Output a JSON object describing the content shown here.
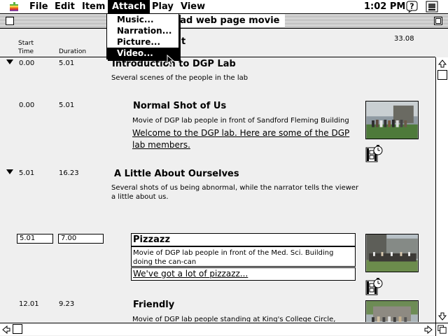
{
  "menubar": {
    "apple_icon": "apple-logo-icon",
    "menus": [
      {
        "label": "File"
      },
      {
        "label": "Edit"
      },
      {
        "label": "Item"
      },
      {
        "label": "Attach"
      },
      {
        "label": "Play"
      },
      {
        "label": "View"
      }
    ],
    "active_menu": "Attach",
    "clock": "1:02 PM",
    "help_icon": "help-balloon-icon",
    "app_icon": "application-icon"
  },
  "attach_menu": {
    "items": [
      {
        "label": "Music..."
      },
      {
        "label": "Narration..."
      },
      {
        "label": "Picture..."
      },
      {
        "label": "Video..."
      }
    ],
    "selected": "Video..."
  },
  "window": {
    "title": "nad web page movie",
    "title_prefix_hidden": "t",
    "columns": {
      "start": "Start\nTime",
      "duration": "Duration"
    },
    "total_duration": "33.08"
  },
  "items": [
    {
      "start": "0.00",
      "duration": "5.01",
      "title": "Introduction to DGP Lab",
      "description": "Several scenes of the people in the lab",
      "type": "group"
    },
    {
      "start": "0.00",
      "duration": "5.01",
      "title": "Normal Shot of Us",
      "description": "Movie of DGP lab people in front of Sandford Fleming Building",
      "narration": "Welcome to the DGP lab.  Here are some of the DGP lab members.",
      "type": "clip"
    },
    {
      "start": "5.01",
      "duration": "16.23",
      "title": "A Little About Ourselves",
      "description": "Several shots of us being abnormal, while the narrator tells the viewer a little about us.",
      "type": "group"
    },
    {
      "start": "5.01",
      "duration": "7.00",
      "title": "Pizzazz",
      "description": "Movie of DGP lab people in front of the Med. Sci. Building doing the can-can",
      "narration": "We've got a lot of pizzazz...",
      "type": "clip-editing"
    },
    {
      "start": "12.01",
      "duration": "9.23",
      "title": "Friendly",
      "description": "Movie of DGP lab people standing at King's College Circle, feeding the papier mache man.",
      "type": "clip"
    }
  ],
  "colors": {
    "selection": "#000000",
    "window_bg": "#efefef"
  }
}
